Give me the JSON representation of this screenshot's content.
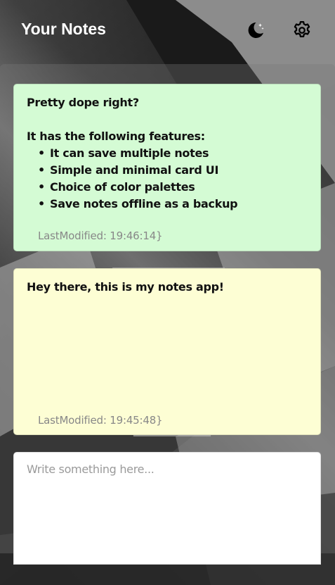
{
  "header": {
    "title": "Your Notes",
    "theme_icon": "moon-stars-icon",
    "settings_icon": "gear-icon"
  },
  "notes": [
    {
      "color": "#d4fbd4",
      "lines": {
        "intro": "Pretty dope right?",
        "features_heading": "It has the following features:",
        "features": [
          "It can save multiple notes",
          "Simple and minimal card UI",
          "Choice of color palettes",
          "Save notes offline as a backup"
        ]
      },
      "last_modified": "LastModified: 19:46:14}"
    },
    {
      "color": "#fdfed4",
      "text": "Hey there, this is my notes app!",
      "last_modified": "LastModified: 19:45:48}"
    }
  ],
  "composer": {
    "placeholder": "Write something here..."
  }
}
